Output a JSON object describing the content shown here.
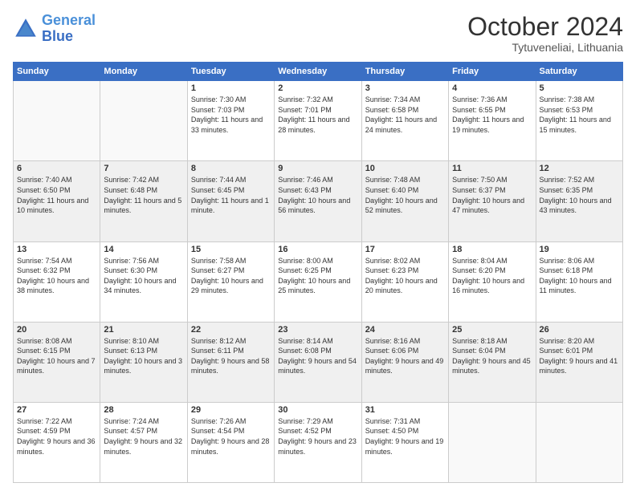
{
  "logo": {
    "line1": "General",
    "line2": "Blue"
  },
  "header": {
    "month": "October 2024",
    "location": "Tytuveneliai, Lithuania"
  },
  "weekdays": [
    "Sunday",
    "Monday",
    "Tuesday",
    "Wednesday",
    "Thursday",
    "Friday",
    "Saturday"
  ],
  "weeks": [
    [
      {
        "day": "",
        "sunrise": "",
        "sunset": "",
        "daylight": ""
      },
      {
        "day": "",
        "sunrise": "",
        "sunset": "",
        "daylight": ""
      },
      {
        "day": "1",
        "sunrise": "Sunrise: 7:30 AM",
        "sunset": "Sunset: 7:03 PM",
        "daylight": "Daylight: 11 hours and 33 minutes."
      },
      {
        "day": "2",
        "sunrise": "Sunrise: 7:32 AM",
        "sunset": "Sunset: 7:01 PM",
        "daylight": "Daylight: 11 hours and 28 minutes."
      },
      {
        "day": "3",
        "sunrise": "Sunrise: 7:34 AM",
        "sunset": "Sunset: 6:58 PM",
        "daylight": "Daylight: 11 hours and 24 minutes."
      },
      {
        "day": "4",
        "sunrise": "Sunrise: 7:36 AM",
        "sunset": "Sunset: 6:55 PM",
        "daylight": "Daylight: 11 hours and 19 minutes."
      },
      {
        "day": "5",
        "sunrise": "Sunrise: 7:38 AM",
        "sunset": "Sunset: 6:53 PM",
        "daylight": "Daylight: 11 hours and 15 minutes."
      }
    ],
    [
      {
        "day": "6",
        "sunrise": "Sunrise: 7:40 AM",
        "sunset": "Sunset: 6:50 PM",
        "daylight": "Daylight: 11 hours and 10 minutes."
      },
      {
        "day": "7",
        "sunrise": "Sunrise: 7:42 AM",
        "sunset": "Sunset: 6:48 PM",
        "daylight": "Daylight: 11 hours and 5 minutes."
      },
      {
        "day": "8",
        "sunrise": "Sunrise: 7:44 AM",
        "sunset": "Sunset: 6:45 PM",
        "daylight": "Daylight: 11 hours and 1 minute."
      },
      {
        "day": "9",
        "sunrise": "Sunrise: 7:46 AM",
        "sunset": "Sunset: 6:43 PM",
        "daylight": "Daylight: 10 hours and 56 minutes."
      },
      {
        "day": "10",
        "sunrise": "Sunrise: 7:48 AM",
        "sunset": "Sunset: 6:40 PM",
        "daylight": "Daylight: 10 hours and 52 minutes."
      },
      {
        "day": "11",
        "sunrise": "Sunrise: 7:50 AM",
        "sunset": "Sunset: 6:37 PM",
        "daylight": "Daylight: 10 hours and 47 minutes."
      },
      {
        "day": "12",
        "sunrise": "Sunrise: 7:52 AM",
        "sunset": "Sunset: 6:35 PM",
        "daylight": "Daylight: 10 hours and 43 minutes."
      }
    ],
    [
      {
        "day": "13",
        "sunrise": "Sunrise: 7:54 AM",
        "sunset": "Sunset: 6:32 PM",
        "daylight": "Daylight: 10 hours and 38 minutes."
      },
      {
        "day": "14",
        "sunrise": "Sunrise: 7:56 AM",
        "sunset": "Sunset: 6:30 PM",
        "daylight": "Daylight: 10 hours and 34 minutes."
      },
      {
        "day": "15",
        "sunrise": "Sunrise: 7:58 AM",
        "sunset": "Sunset: 6:27 PM",
        "daylight": "Daylight: 10 hours and 29 minutes."
      },
      {
        "day": "16",
        "sunrise": "Sunrise: 8:00 AM",
        "sunset": "Sunset: 6:25 PM",
        "daylight": "Daylight: 10 hours and 25 minutes."
      },
      {
        "day": "17",
        "sunrise": "Sunrise: 8:02 AM",
        "sunset": "Sunset: 6:23 PM",
        "daylight": "Daylight: 10 hours and 20 minutes."
      },
      {
        "day": "18",
        "sunrise": "Sunrise: 8:04 AM",
        "sunset": "Sunset: 6:20 PM",
        "daylight": "Daylight: 10 hours and 16 minutes."
      },
      {
        "day": "19",
        "sunrise": "Sunrise: 8:06 AM",
        "sunset": "Sunset: 6:18 PM",
        "daylight": "Daylight: 10 hours and 11 minutes."
      }
    ],
    [
      {
        "day": "20",
        "sunrise": "Sunrise: 8:08 AM",
        "sunset": "Sunset: 6:15 PM",
        "daylight": "Daylight: 10 hours and 7 minutes."
      },
      {
        "day": "21",
        "sunrise": "Sunrise: 8:10 AM",
        "sunset": "Sunset: 6:13 PM",
        "daylight": "Daylight: 10 hours and 3 minutes."
      },
      {
        "day": "22",
        "sunrise": "Sunrise: 8:12 AM",
        "sunset": "Sunset: 6:11 PM",
        "daylight": "Daylight: 9 hours and 58 minutes."
      },
      {
        "day": "23",
        "sunrise": "Sunrise: 8:14 AM",
        "sunset": "Sunset: 6:08 PM",
        "daylight": "Daylight: 9 hours and 54 minutes."
      },
      {
        "day": "24",
        "sunrise": "Sunrise: 8:16 AM",
        "sunset": "Sunset: 6:06 PM",
        "daylight": "Daylight: 9 hours and 49 minutes."
      },
      {
        "day": "25",
        "sunrise": "Sunrise: 8:18 AM",
        "sunset": "Sunset: 6:04 PM",
        "daylight": "Daylight: 9 hours and 45 minutes."
      },
      {
        "day": "26",
        "sunrise": "Sunrise: 8:20 AM",
        "sunset": "Sunset: 6:01 PM",
        "daylight": "Daylight: 9 hours and 41 minutes."
      }
    ],
    [
      {
        "day": "27",
        "sunrise": "Sunrise: 7:22 AM",
        "sunset": "Sunset: 4:59 PM",
        "daylight": "Daylight: 9 hours and 36 minutes."
      },
      {
        "day": "28",
        "sunrise": "Sunrise: 7:24 AM",
        "sunset": "Sunset: 4:57 PM",
        "daylight": "Daylight: 9 hours and 32 minutes."
      },
      {
        "day": "29",
        "sunrise": "Sunrise: 7:26 AM",
        "sunset": "Sunset: 4:54 PM",
        "daylight": "Daylight: 9 hours and 28 minutes."
      },
      {
        "day": "30",
        "sunrise": "Sunrise: 7:29 AM",
        "sunset": "Sunset: 4:52 PM",
        "daylight": "Daylight: 9 hours and 23 minutes."
      },
      {
        "day": "31",
        "sunrise": "Sunrise: 7:31 AM",
        "sunset": "Sunset: 4:50 PM",
        "daylight": "Daylight: 9 hours and 19 minutes."
      },
      {
        "day": "",
        "sunrise": "",
        "sunset": "",
        "daylight": ""
      },
      {
        "day": "",
        "sunrise": "",
        "sunset": "",
        "daylight": ""
      }
    ]
  ]
}
